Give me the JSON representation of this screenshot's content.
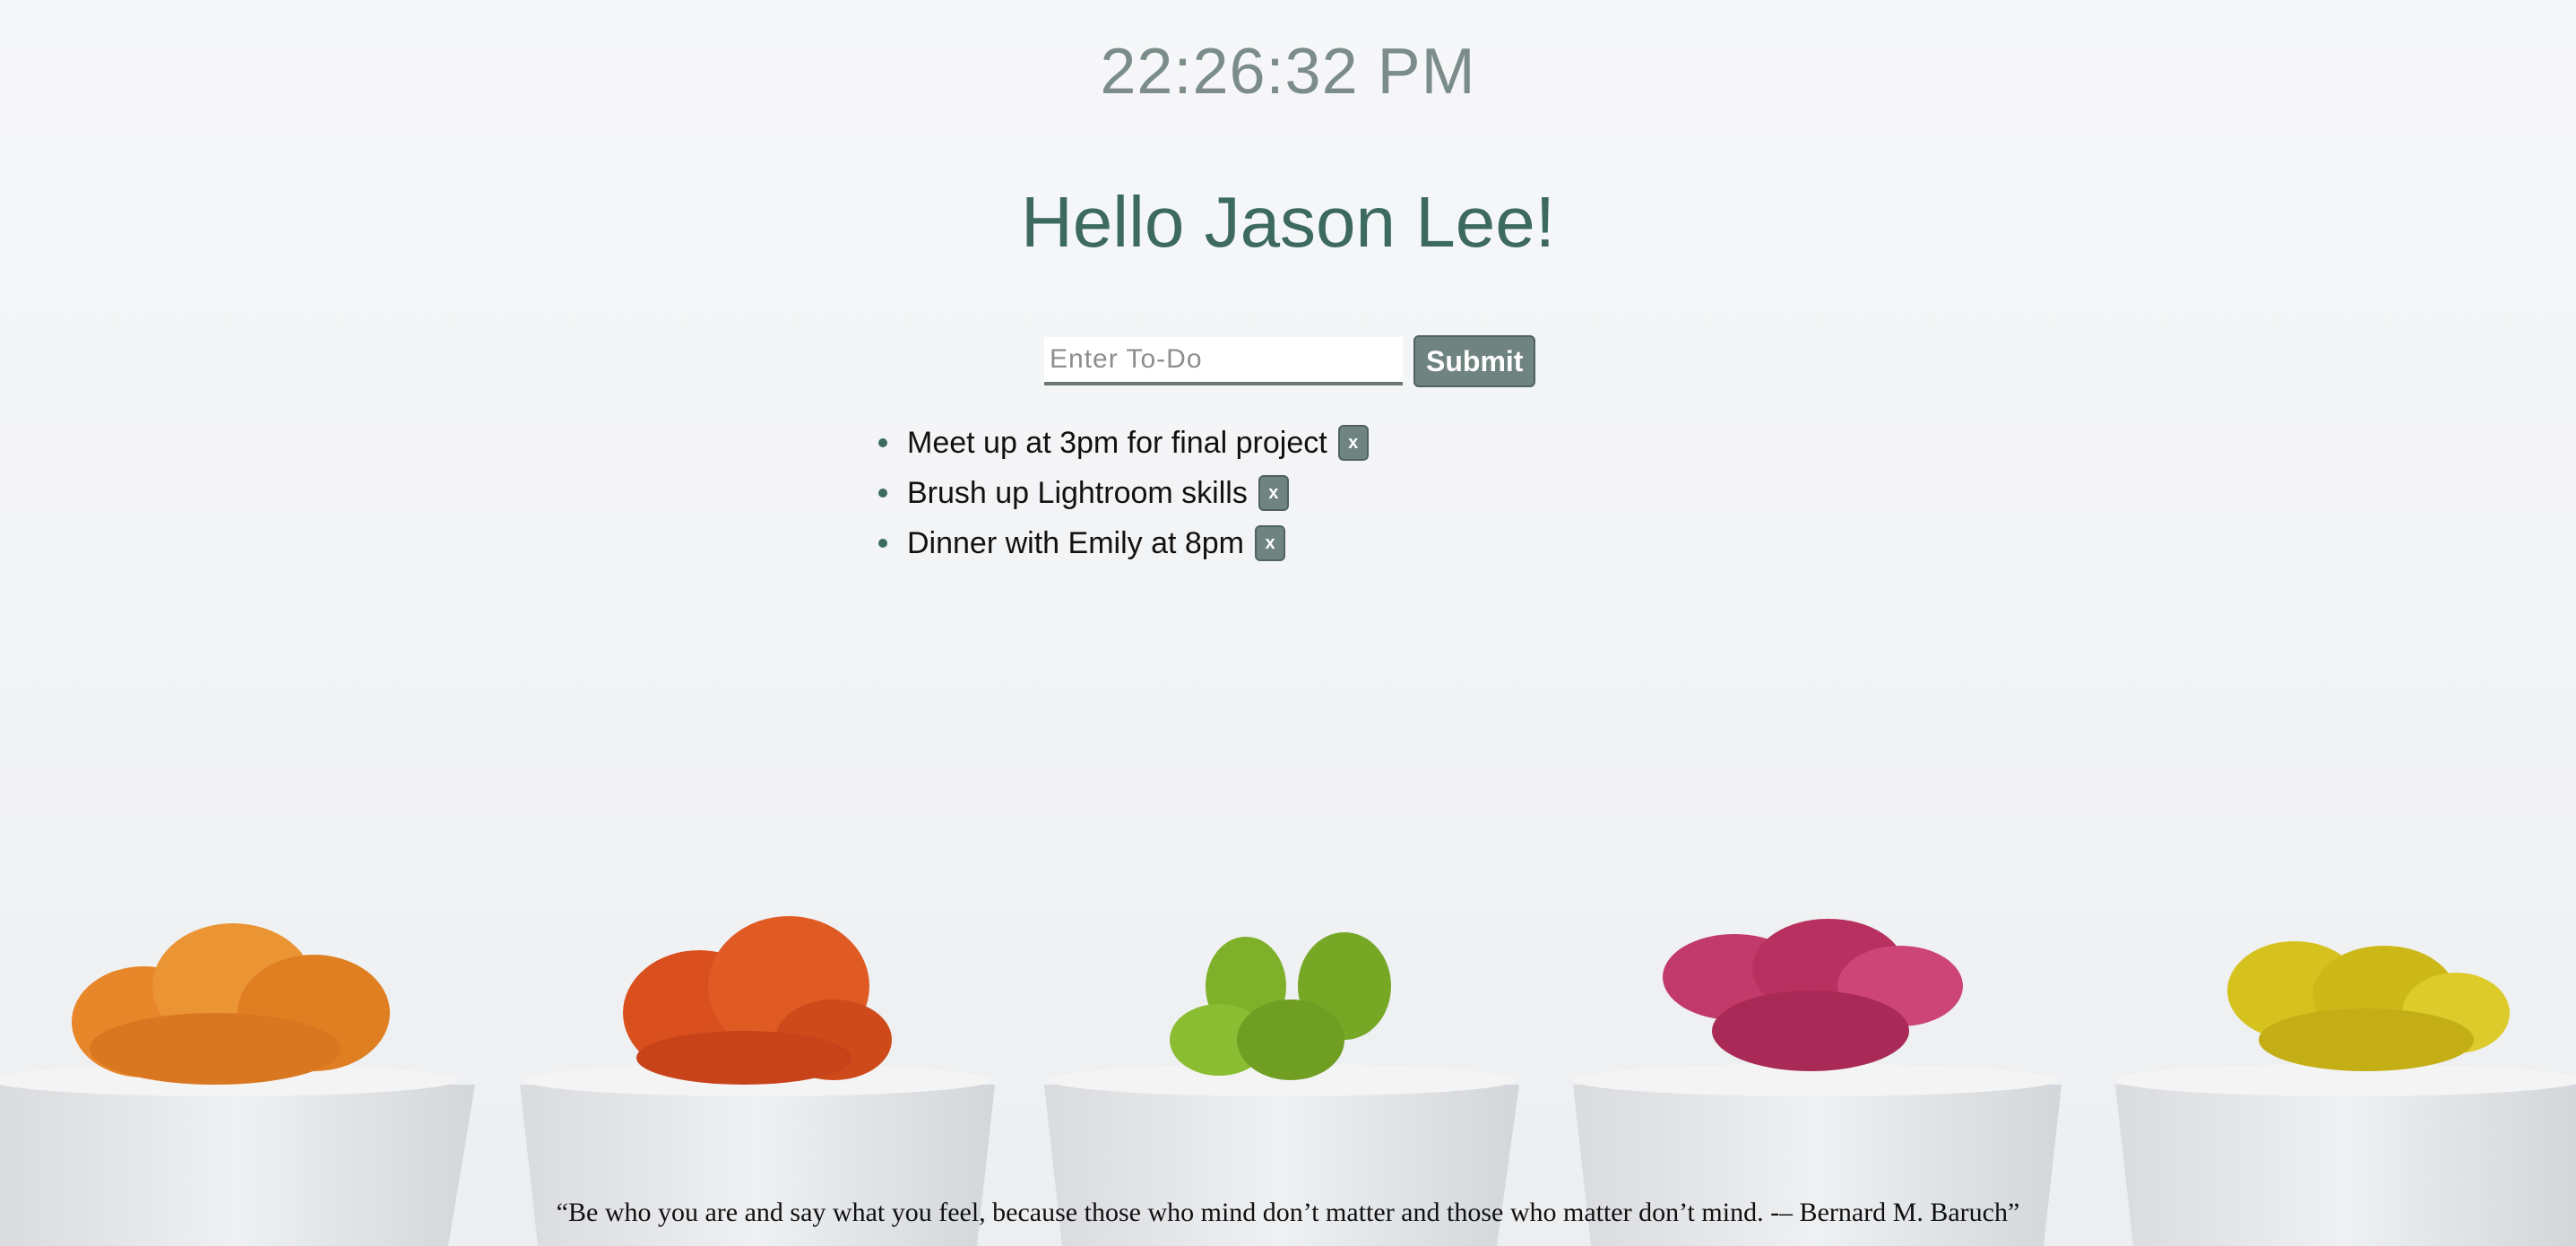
{
  "clock": {
    "time": "22:26:32 PM"
  },
  "greeting": {
    "text": "Hello Jason Lee!"
  },
  "todo_form": {
    "placeholder": "Enter To-Do",
    "submit_label": "Submit"
  },
  "todos": [
    {
      "text": "Meet up at 3pm for final project",
      "delete_label": "x"
    },
    {
      "text": "Brush up Lightroom skills",
      "delete_label": "x"
    },
    {
      "text": "Dinner with Emily at 8pm",
      "delete_label": "x"
    }
  ],
  "quote": {
    "text": "“Be who you are and say what you feel, because those who mind don’t matter and those who matter don’t mind. -– Bernard M. Baruch”"
  },
  "background": {
    "description_icon": "potted-cactus-row",
    "colors": {
      "orange": "#e8862a",
      "red_orange": "#d9501e",
      "green": "#7fb02a",
      "pink": "#c23a6a",
      "yellow": "#d6c21f",
      "pot": "#e9eaec"
    }
  }
}
